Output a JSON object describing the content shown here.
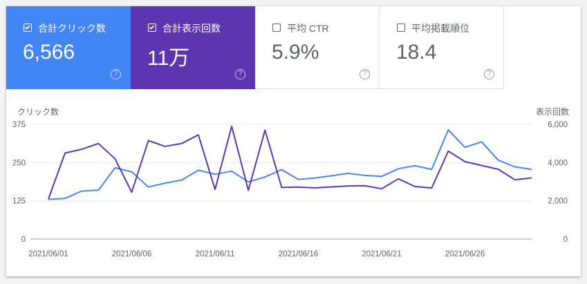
{
  "metrics": [
    {
      "label": "合計クリック数",
      "value": "6,566",
      "checked": true,
      "color": "#4285f4"
    },
    {
      "label": "合計表示回数",
      "value": "11万",
      "checked": true,
      "color": "#5e35b1"
    },
    {
      "label": "平均 CTR",
      "value": "5.9%",
      "checked": false,
      "color": "#ffffff"
    },
    {
      "label": "平均掲載順位",
      "value": "18.4",
      "checked": false,
      "color": "#ffffff"
    }
  ],
  "help_glyph": "?",
  "chart_data": {
    "type": "line",
    "left_axis_label": "クリック数",
    "right_axis_label": "表示回数",
    "x_ticks": [
      "2021/06/01",
      "2021/06/06",
      "2021/06/11",
      "2021/06/16",
      "2021/06/21",
      "2021/06/26"
    ],
    "left_ticks": [
      "375",
      "250",
      "125",
      "0"
    ],
    "right_ticks": [
      "6,000",
      "4,000",
      "2,000",
      "0"
    ],
    "ylim_left": [
      0,
      375
    ],
    "ylim_right": [
      0,
      6000
    ],
    "x": [
      "2021/06/01",
      "2021/06/02",
      "2021/06/03",
      "2021/06/04",
      "2021/06/05",
      "2021/06/06",
      "2021/06/07",
      "2021/06/08",
      "2021/06/09",
      "2021/06/10",
      "2021/06/11",
      "2021/06/12",
      "2021/06/13",
      "2021/06/14",
      "2021/06/15",
      "2021/06/16",
      "2021/06/17",
      "2021/06/18",
      "2021/06/19",
      "2021/06/20",
      "2021/06/21",
      "2021/06/22",
      "2021/06/23",
      "2021/06/24",
      "2021/06/25",
      "2021/06/26",
      "2021/06/27",
      "2021/06/28",
      "2021/06/29",
      "2021/06/30"
    ],
    "series": [
      {
        "axis": "left",
        "color": "#4285f4",
        "values": [
          130,
          133,
          157,
          160,
          233,
          220,
          170,
          183,
          193,
          225,
          212,
          222,
          187,
          203,
          227,
          195,
          200,
          207,
          215,
          208,
          205,
          230,
          240,
          228,
          357,
          300,
          318,
          258,
          236,
          228
        ]
      },
      {
        "axis": "right",
        "color": "#5e35b1",
        "values": [
          2100,
          4500,
          4700,
          5000,
          4200,
          2450,
          5150,
          4850,
          5000,
          5450,
          2600,
          5900,
          2550,
          5700,
          2700,
          2720,
          2680,
          2730,
          2780,
          2790,
          2630,
          3150,
          2750,
          2670,
          4600,
          4050,
          3850,
          3650,
          3100,
          3200
        ]
      }
    ]
  }
}
